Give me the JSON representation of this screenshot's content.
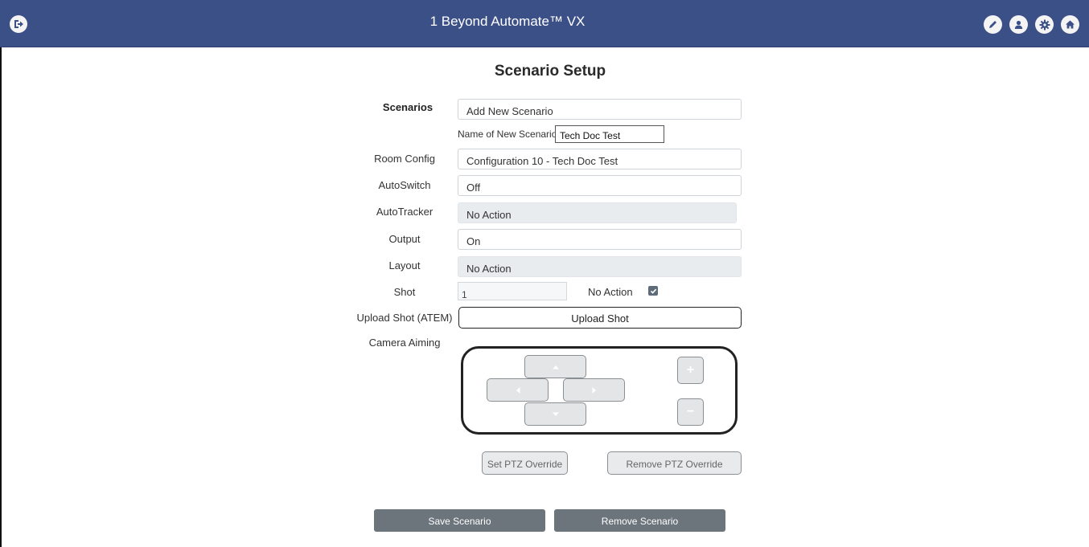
{
  "app": {
    "title": "1 Beyond Automate™ VX",
    "header_color": "#3c5088",
    "icons": [
      "logout-icon",
      "pencil-icon",
      "user-icon",
      "gear-icon",
      "home-icon"
    ]
  },
  "page": {
    "title": "Scenario Setup"
  },
  "form": {
    "scenarios": {
      "label": "Scenarios",
      "value": "Add New Scenario"
    },
    "new_name": {
      "label": "Name of New Scenario",
      "value": "Tech Doc Test"
    },
    "room_config": {
      "label": "Room Config",
      "value": "Configuration 10 - Tech Doc Test"
    },
    "autoswitch": {
      "label": "AutoSwitch",
      "value": "Off"
    },
    "autotracker": {
      "label": "AutoTracker",
      "value": "No Action"
    },
    "output": {
      "label": "Output",
      "value": "On"
    },
    "layout": {
      "label": "Layout",
      "value": "No Action"
    },
    "shot": {
      "label": "Shot",
      "value": "1",
      "no_action_label": "No Action",
      "no_action_checked": true
    },
    "upload_shot": {
      "label": "Upload Shot (ATEM)",
      "button": "Upload Shot"
    },
    "camera_aiming": {
      "label": "Camera Aiming"
    }
  },
  "ptz": {
    "set_override": "Set PTZ Override",
    "remove_override": "Remove PTZ Override",
    "zoom_in": "+",
    "zoom_out": "−"
  },
  "actions": {
    "save": "Save Scenario",
    "remove": "Remove Scenario"
  }
}
